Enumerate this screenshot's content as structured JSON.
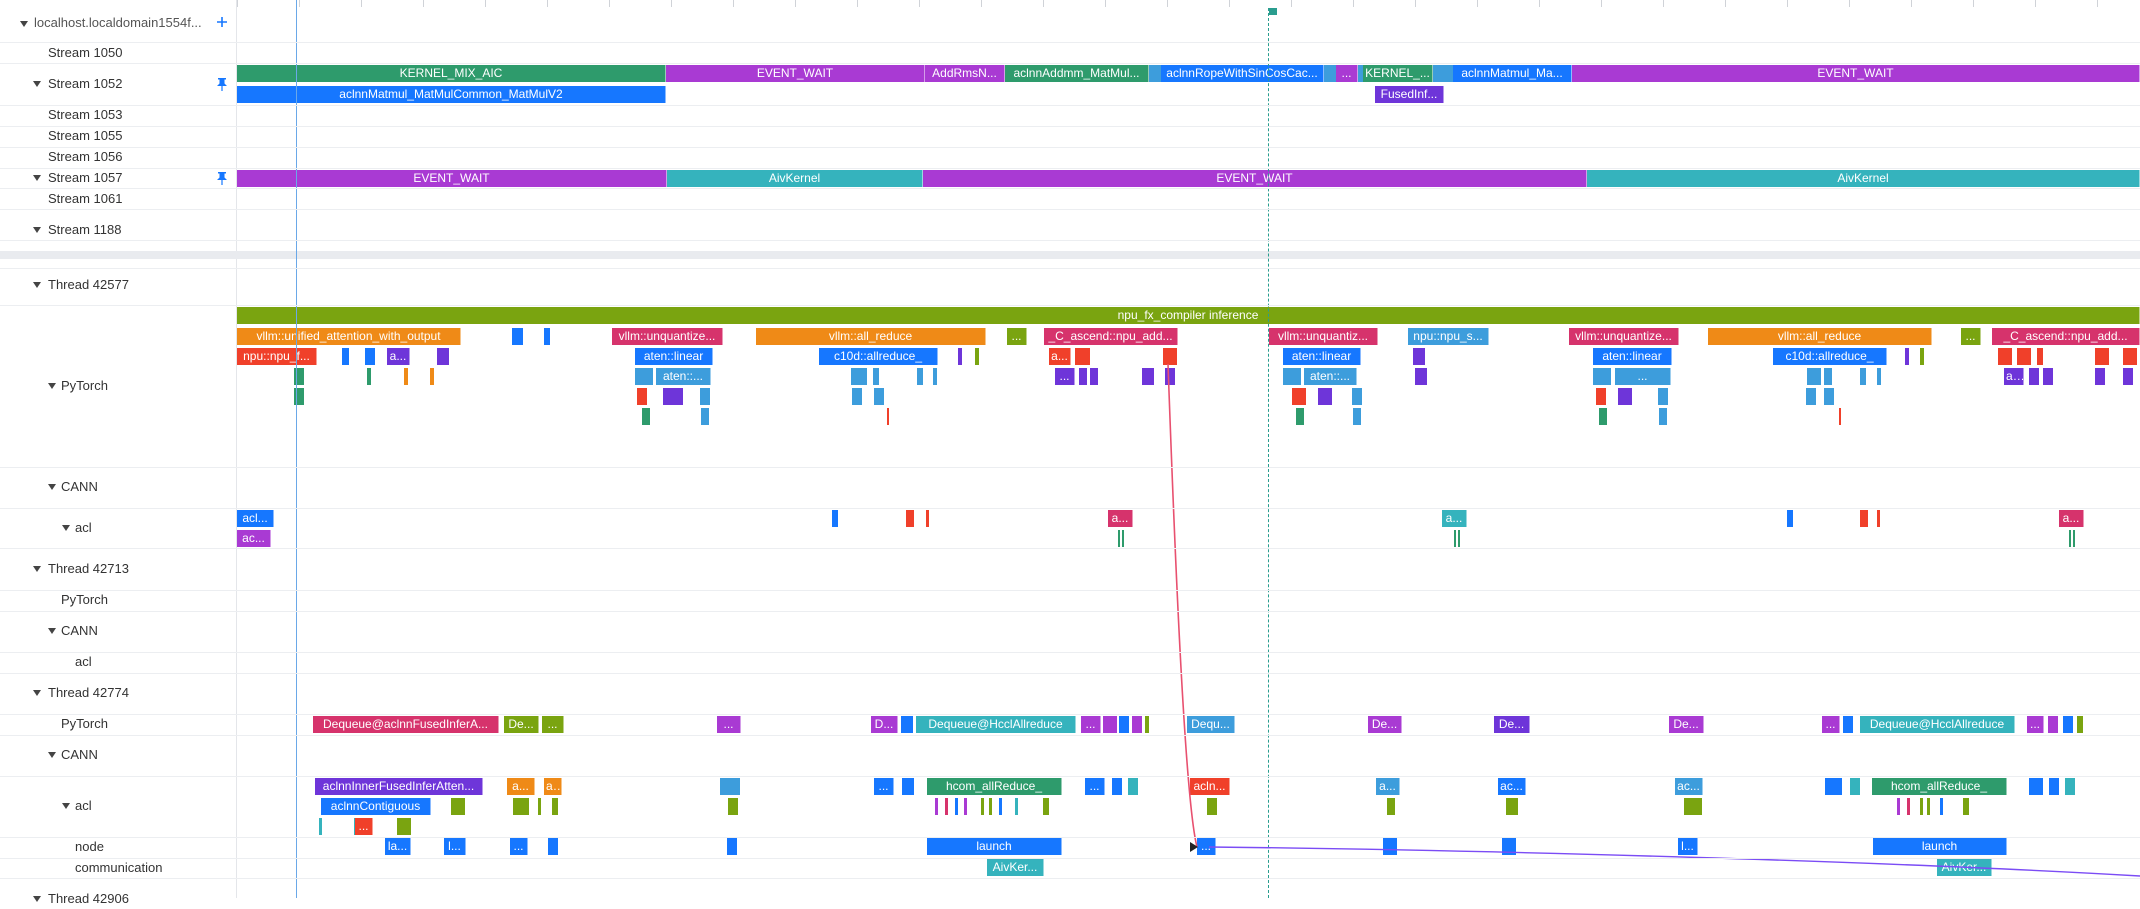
{
  "colors": {
    "green": "#2e9b6c",
    "purple": "#a93ad3",
    "blue": "#1677ff",
    "teal": "#35b3bd",
    "olive": "#7aa410",
    "pink": "#d6336c",
    "orange": "#ef8a17",
    "red": "#f0402a",
    "violet": "#6e35d9",
    "lightblue": "#3d9ddc"
  },
  "sidebar": {
    "header_label": "localhost.localdomain1554f...",
    "rows": [
      {
        "label": "Stream 1050"
      },
      {
        "label": "Stream 1052"
      },
      {
        "label": "Stream 1053"
      },
      {
        "label": "Stream 1055"
      },
      {
        "label": "Stream 1056"
      },
      {
        "label": "Stream 1057"
      },
      {
        "label": "Stream 1061"
      },
      {
        "label": "Stream 1188"
      },
      {
        "label": "Thread 42577"
      },
      {
        "label": "PyTorch"
      },
      {
        "label": "CANN"
      },
      {
        "label": "acl"
      },
      {
        "label": "Thread 42713"
      },
      {
        "label": "PyTorch"
      },
      {
        "label": "CANN"
      },
      {
        "label": "acl"
      },
      {
        "label": "Thread 42774"
      },
      {
        "label": "PyTorch"
      },
      {
        "label": "CANN"
      },
      {
        "label": "acl"
      },
      {
        "label": "node"
      },
      {
        "label": "communication"
      },
      {
        "label": "Thread 42906"
      }
    ]
  },
  "blocks": {
    "s1052a": [
      "KERNEL_MIX_AIC",
      "EVENT_WAIT",
      "AddRmsN...",
      "aclnnAddmm_MatMul...",
      "aclnnRopeWithSinCosCac...",
      "...",
      "KERNEL_...",
      "aclnnMatmul_Ma...",
      "EVENT_WAIT"
    ],
    "s1052b": [
      "aclnnMatmul_MatMulCommon_MatMulV2",
      "FusedInf..."
    ],
    "s1057": [
      "EVENT_WAIT",
      "AivKernel",
      "EVENT_WAIT",
      "AivKernel"
    ],
    "inference": "npu_fx_compiler inference",
    "py1": [
      "vllm::unified_attention_with_output",
      "vllm::unquantize...",
      "vllm::all_reduce",
      "...",
      "_C_ascend::npu_add...",
      "vllm::unquantiz...",
      "npu::npu_s...",
      "vllm::unquantize...",
      "vllm::all_reduce",
      "...",
      "_C_ascend::npu_add..."
    ],
    "py2": [
      "npu::npu_f...",
      "a...",
      "aten::linear",
      "c10d::allreduce_",
      "a...",
      "aten::linear",
      "aten::linear",
      "c10d::allreduce_"
    ],
    "py3": [
      "aten::...",
      "...",
      "aten::...",
      "...",
      "aten::..."
    ],
    "acl1": [
      "acl...",
      "a...",
      "a...",
      "a..."
    ],
    "acl1b": [
      "ac..."
    ],
    "t3py": [
      "Dequeue@aclnnFusedInferA...",
      "De...",
      "...",
      "...",
      "D...",
      "Dequeue@HcclAllreduce",
      "...",
      "...",
      "Dequ...",
      "De...",
      "De...",
      "De...",
      "...",
      "Dequeue@HcclAllreduce",
      "...",
      "..."
    ],
    "t3acl": [
      "aclnnInnerFusedInferAtten...",
      "a...",
      "a...",
      "a...",
      "...",
      "hcom_allReduce_",
      "...",
      "...",
      "acln...",
      "a...",
      "ac...",
      "ac...",
      "hcom_allReduce_"
    ],
    "t3acl2": [
      "aclnnContiguous"
    ],
    "node": [
      "la...",
      "l...",
      "...",
      "...",
      "launch",
      "...",
      "l...",
      "launch"
    ],
    "comm": [
      "AivKer...",
      "AivKer..."
    ],
    "small": [
      "..."
    ]
  }
}
